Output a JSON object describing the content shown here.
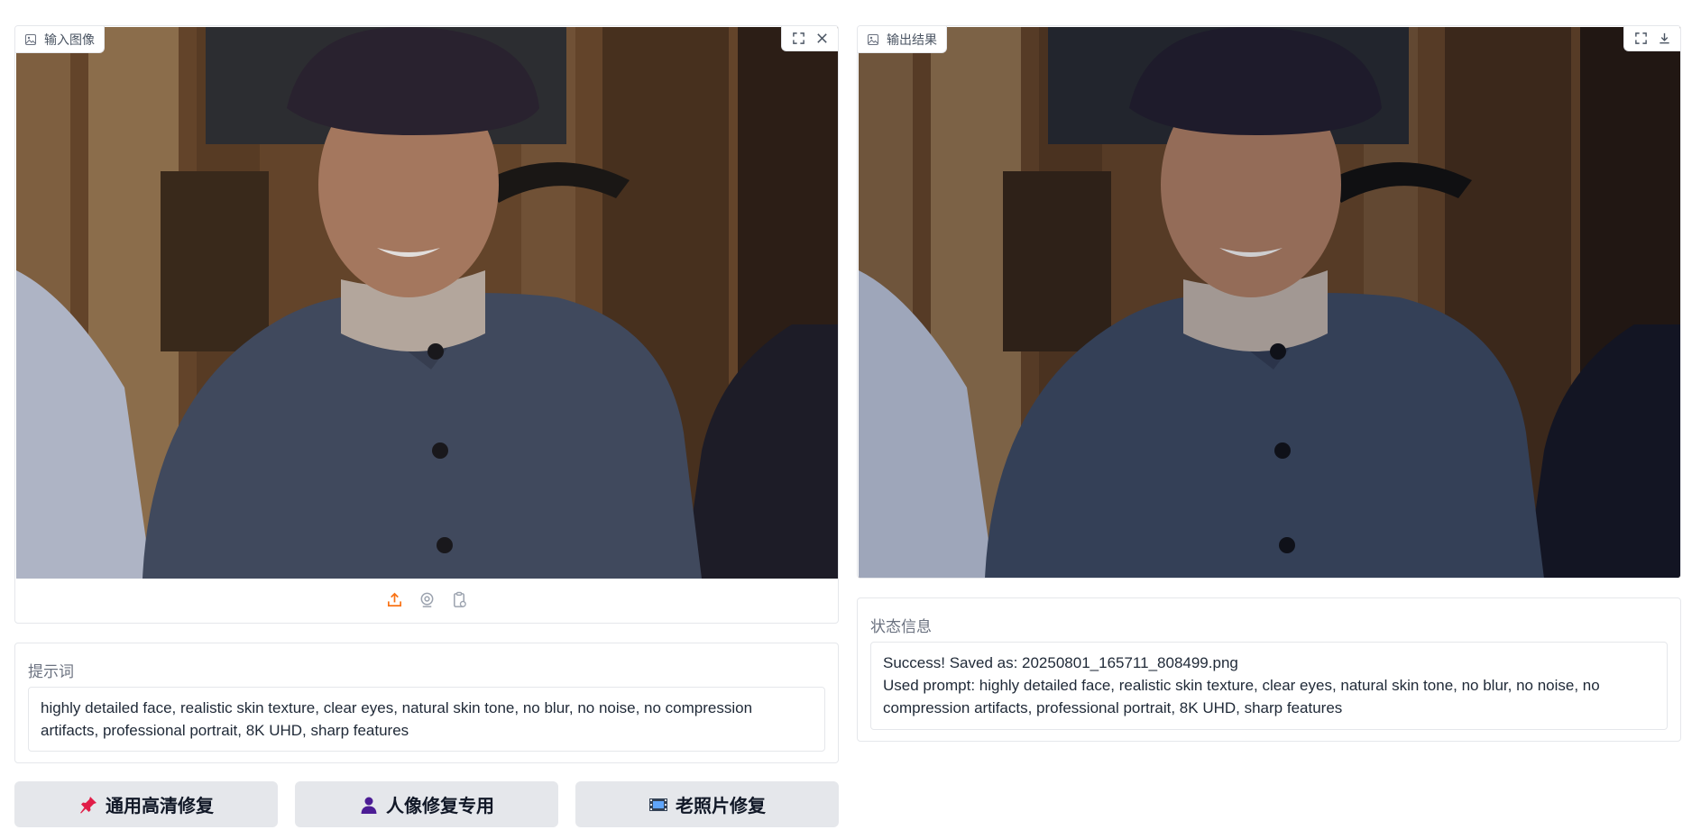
{
  "input_panel": {
    "label": "输入图像",
    "icon": "image-icon",
    "tools": [
      "fullscreen-icon",
      "close-icon"
    ],
    "upload_sources": [
      "upload-icon",
      "webcam-icon",
      "clipboard-icon"
    ],
    "photo_desc": "old man in blue jacket and beret"
  },
  "output_panel": {
    "label": "输出结果",
    "icon": "image-icon",
    "tools": [
      "fullscreen-icon",
      "download-icon"
    ]
  },
  "prompt": {
    "label": "提示词",
    "value": "highly detailed face, realistic skin texture, clear eyes, natural skin tone, no blur, no noise, no compression artifacts, professional portrait, 8K UHD, sharp features"
  },
  "status": {
    "label": "状态信息",
    "line1": "Success! Saved as: 20250801_165711_808499.png",
    "line2": "Used prompt: highly detailed face, realistic skin texture, clear eyes, natural skin tone, no blur, no noise, no compression artifacts, professional portrait, 8K UHD, sharp features"
  },
  "buttons": [
    {
      "label": "通用高清修复",
      "icon": "pushpin-icon"
    },
    {
      "label": "人像修复专用",
      "icon": "person-icon"
    },
    {
      "label": "老照片修复",
      "icon": "film-icon"
    }
  ],
  "colors": {
    "accent_orange": "#f97316",
    "button_bg": "#e5e7eb",
    "border": "#e5e7eb"
  }
}
